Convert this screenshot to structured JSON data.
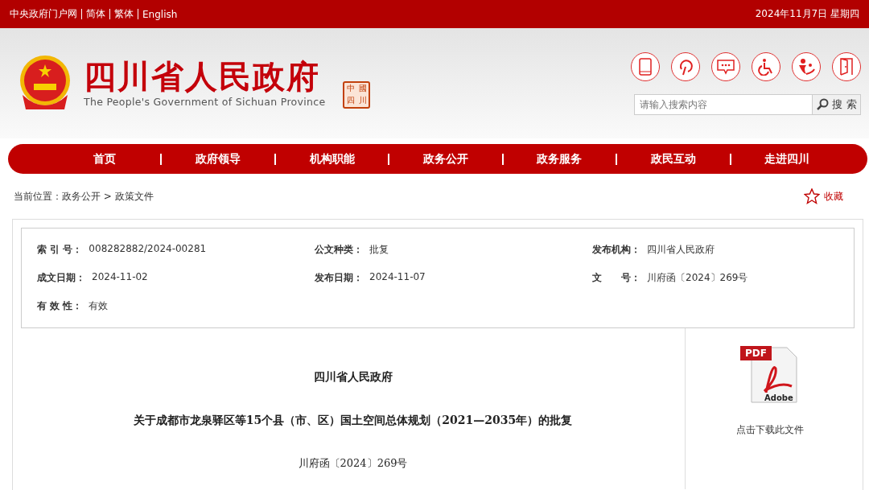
{
  "top_bar": {
    "links": [
      "中央政府门户网",
      "简体",
      "繁体",
      "English"
    ],
    "date": "2024年11月7日 星期四"
  },
  "header": {
    "title": "四川省人民政府",
    "subtitle": "The People's Government of Sichuan Province",
    "seal": [
      "中",
      "國",
      "四",
      "川"
    ],
    "search": {
      "placeholder": "请输入搜索内容",
      "button": "搜 索"
    }
  },
  "nav": [
    "首页",
    "政府领导",
    "机构职能",
    "政务公开",
    "政务服务",
    "政民互动",
    "走进四川"
  ],
  "breadcrumb": "当前位置：政务公开 > 政策文件",
  "favorite": "收藏",
  "meta": [
    {
      "label": "索 引 号：",
      "value": "008282882/2024-00281"
    },
    {
      "label": "公文种类：",
      "value": "批复"
    },
    {
      "label": "发布机构：",
      "value": "四川省人民政府"
    },
    {
      "label": "成文日期：",
      "value": "2024-11-02"
    },
    {
      "label": "发布日期：",
      "value": "2024-11-07"
    },
    {
      "label": "文　　号：",
      "value": "川府函〔2024〕269号"
    },
    {
      "label": "有 效 性：",
      "value": "有效"
    }
  ],
  "document": {
    "issuer": "四川省人民政府",
    "title": "关于成都市龙泉驿区等15个县（市、区）国土空间总体规划（2021—2035年）的批复",
    "number": "川府函〔2024〕269号"
  },
  "download": {
    "badge": "PDF",
    "brand": "Adobe",
    "label": "点击下载此文件"
  }
}
